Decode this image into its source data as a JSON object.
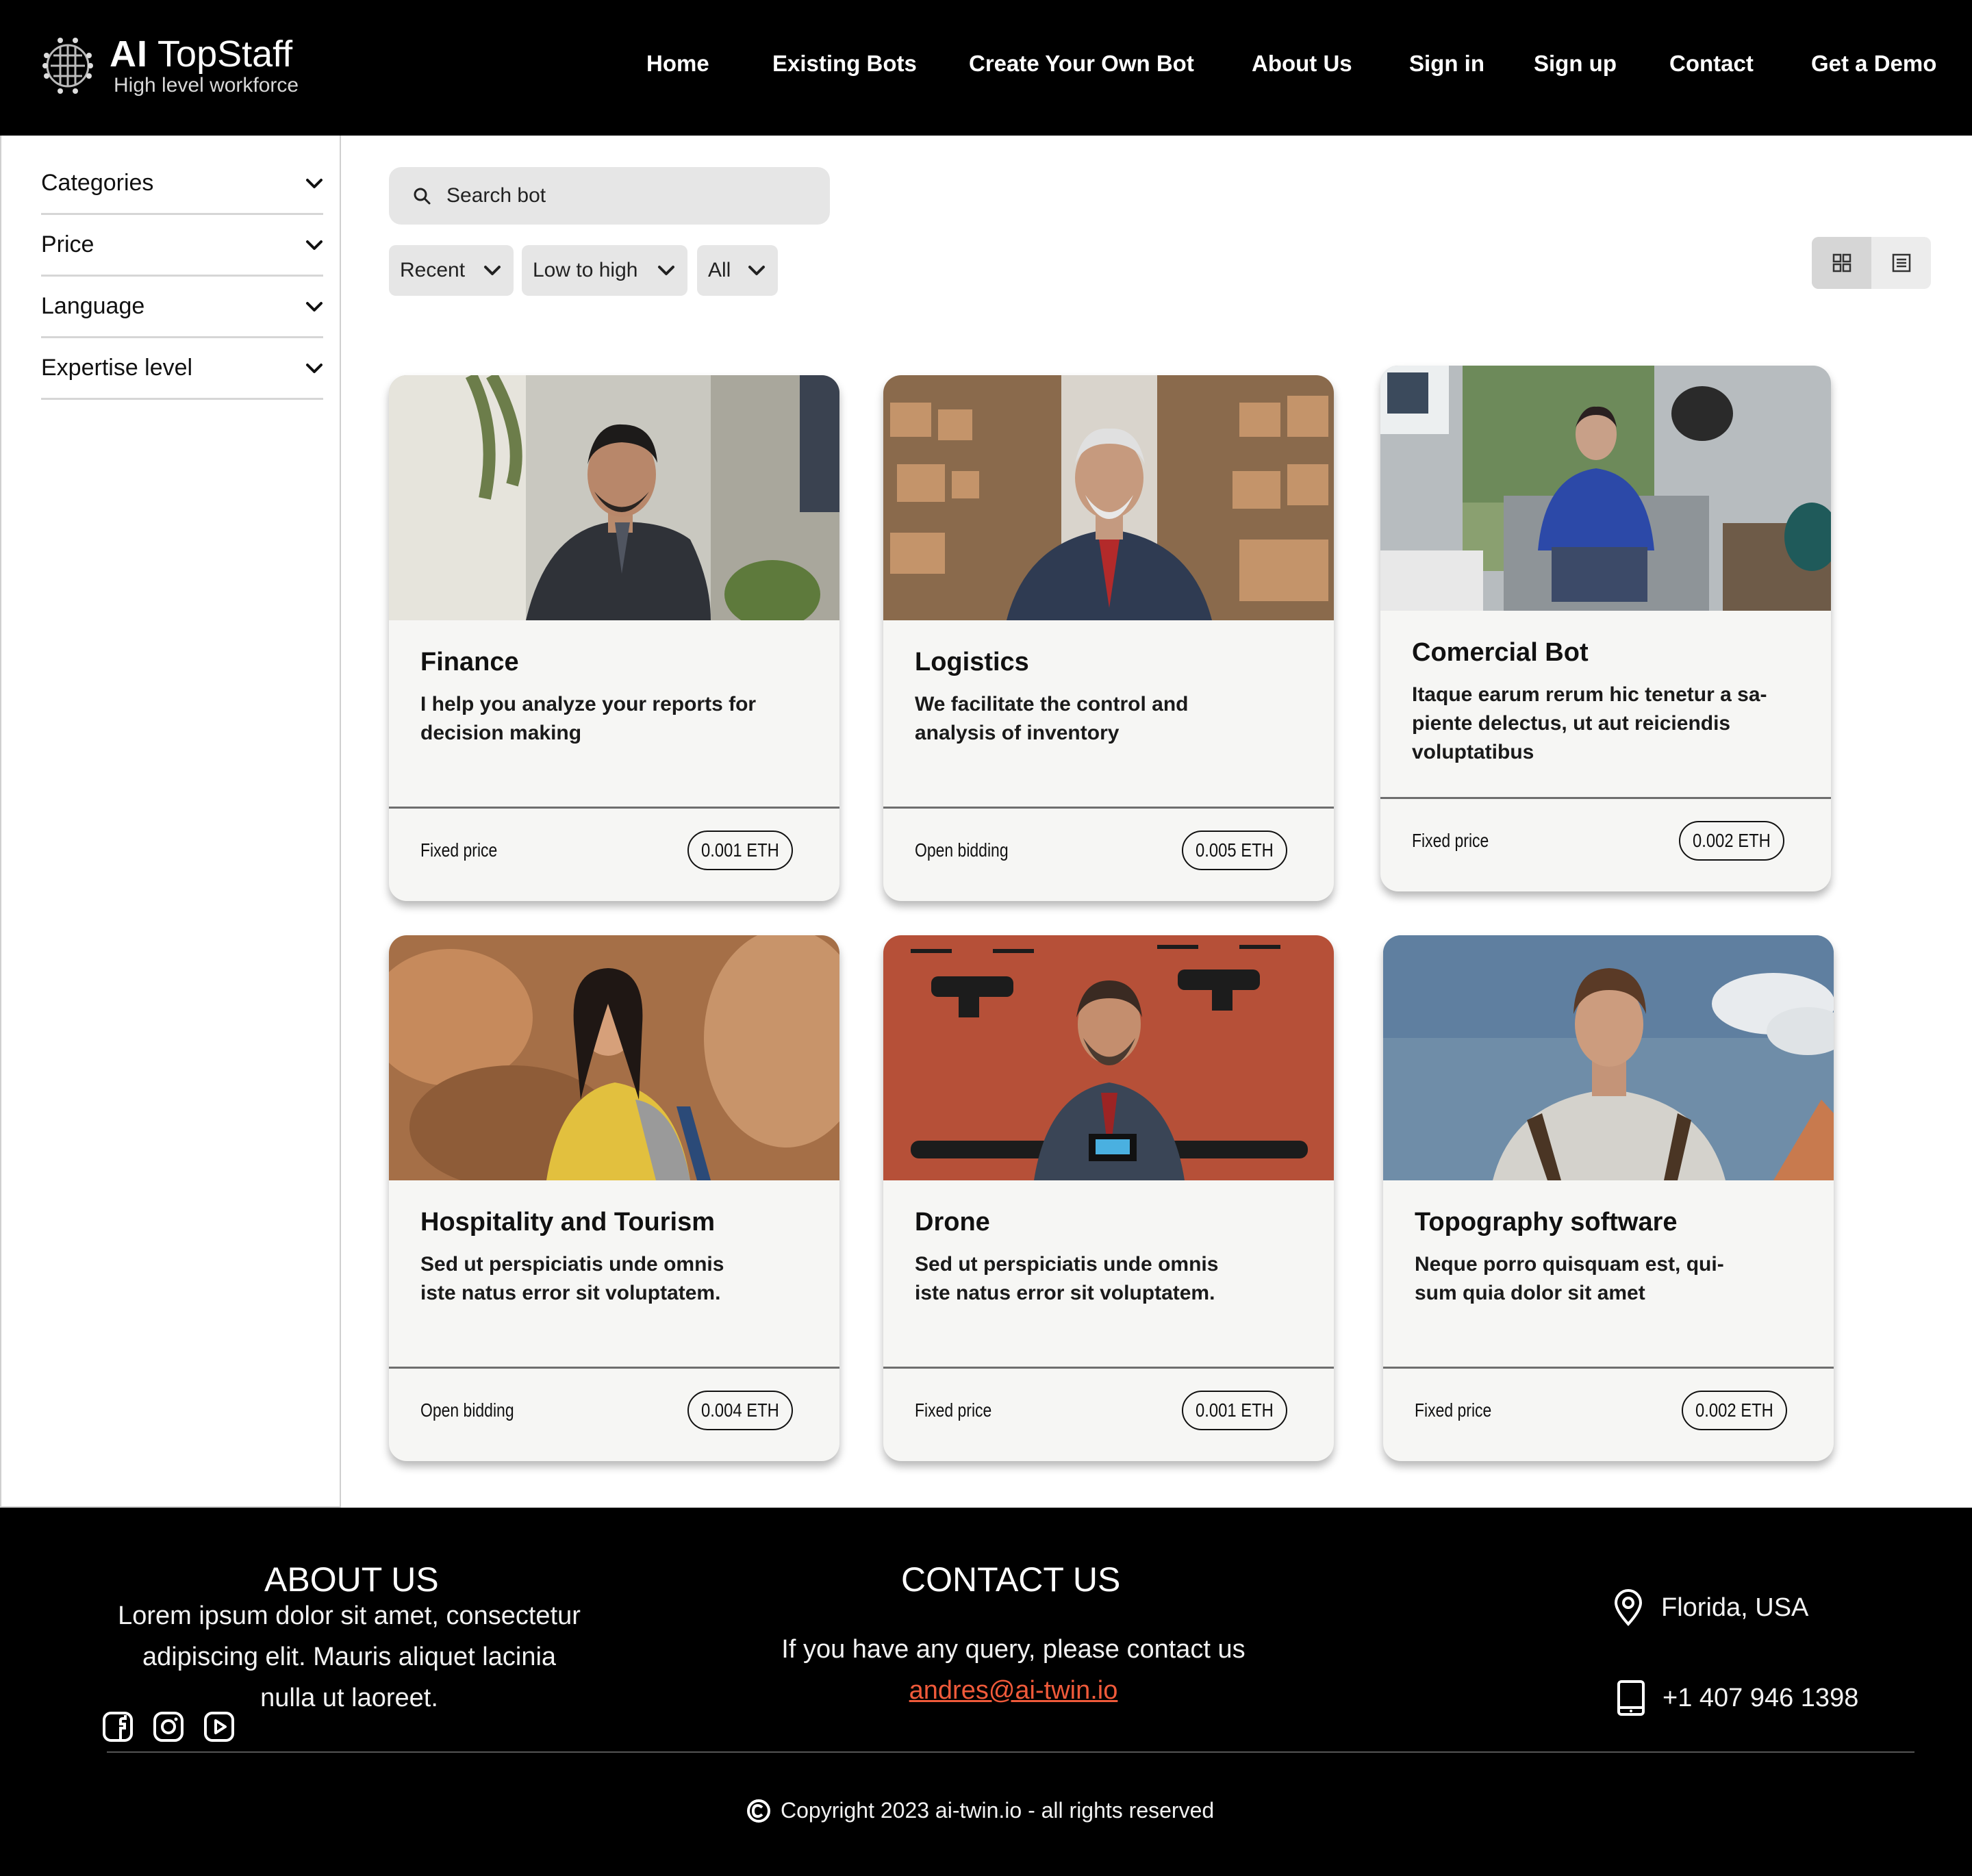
{
  "brand": {
    "title_bold": "AI",
    "title_rest": "TopStaff",
    "tagline": "High level workforce"
  },
  "nav": {
    "home": "Home",
    "existing_bots": "Existing Bots",
    "create_bot": "Create Your Own Bot",
    "about": "About Us",
    "sign_in": "Sign in",
    "sign_up": "Sign up",
    "contact": "Contact",
    "demo": "Get a Demo"
  },
  "filters": {
    "categories": "Categories",
    "price": "Price",
    "language": "Language",
    "expertise": "Expertise level"
  },
  "search": {
    "placeholder": "Search bot"
  },
  "sort": {
    "recent": "Recent",
    "price_order": "Low to high",
    "type": "All"
  },
  "cards": [
    {
      "title": "Finance",
      "desc1": "I help you analyze your reports for",
      "desc2": "decision making",
      "desc3": "",
      "pricing": "Fixed price",
      "price": "0.001 ETH"
    },
    {
      "title": "Logistics",
      "desc1": "We facilitate the control and",
      "desc2": " analysis of inventory",
      "desc3": "",
      "pricing": "Open bidding",
      "price": "0.005 ETH"
    },
    {
      "title": "Comercial Bot",
      "desc1": "Itaque earum rerum hic tenetur a sa-",
      "desc2": "piente delectus, ut aut reiciendis",
      "desc3": "voluptatibus",
      "pricing": "Fixed price",
      "price": "0.002 ETH"
    },
    {
      "title": "Hospitality and Tourism",
      "desc1": "Sed ut perspiciatis unde omnis",
      "desc2": " iste natus error sit voluptatem.",
      "desc3": "",
      "pricing": "Open bidding",
      "price": "0.004 ETH"
    },
    {
      "title": "Drone",
      "desc1": "Sed ut perspiciatis unde omnis",
      "desc2": " iste natus error sit voluptatem.",
      "desc3": "",
      "pricing": "Fixed price",
      "price": "0.001 ETH"
    },
    {
      "title": "Topography software",
      "desc1": "Neque porro quisquam est, qui-",
      "desc2": "sum quia dolor sit amet",
      "desc3": "",
      "pricing": "Fixed price",
      "price": "0.002 ETH"
    }
  ],
  "footer": {
    "about_heading": "ABOUT US",
    "about_line1": "Lorem ipsum dolor sit amet, consectetur",
    "about_line2": "adipiscing elit. Mauris aliquet lacinia",
    "about_line3": "nulla ut laoreet.",
    "contact_heading": "CONTACT US",
    "contact_text": "If you have any query, please contact us",
    "email": "andres@ai-twin.io",
    "location": "Florida, USA",
    "phone": "+1 407 946 1398",
    "copyright": "Copyright 2023 ai-twin.io - all rights reserved",
    "social_icons": [
      "facebook-icon",
      "instagram-icon",
      "youtube-icon"
    ]
  },
  "colors": {
    "header_bg": "#000000",
    "link_accent": "#f05a3a",
    "card_bg": "#f6f6f4"
  }
}
